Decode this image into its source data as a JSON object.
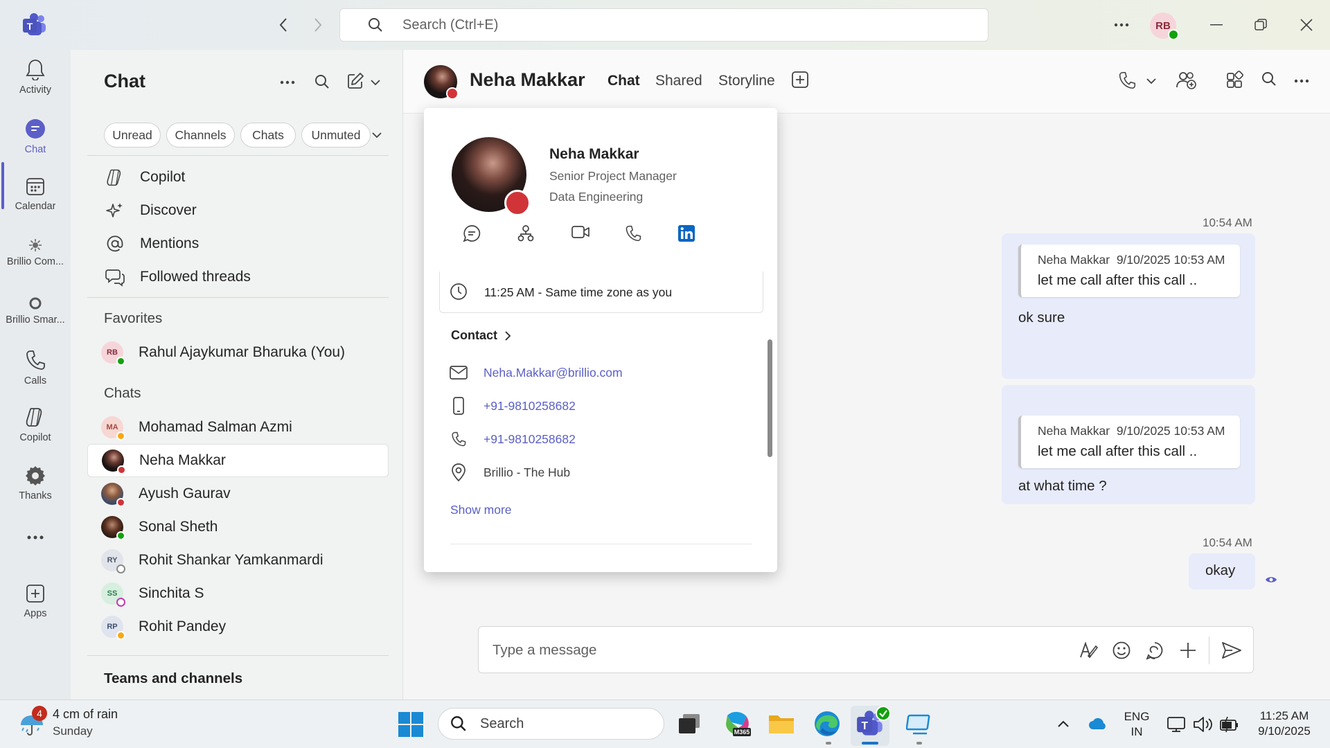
{
  "titlebar": {
    "search_placeholder": "Search (Ctrl+E)",
    "user_initials": "RB"
  },
  "rail": {
    "items": [
      {
        "label": "Activity"
      },
      {
        "label": "Chat"
      },
      {
        "label": "Calendar"
      },
      {
        "label": "Brillio Com..."
      },
      {
        "label": "Brillio Smar..."
      },
      {
        "label": "Calls"
      },
      {
        "label": "Copilot"
      },
      {
        "label": "Thanks"
      },
      {
        "label": "Apps"
      }
    ],
    "more_label": "..."
  },
  "list": {
    "title": "Chat",
    "filters": [
      "Unread",
      "Channels",
      "Chats",
      "Unmuted"
    ],
    "nav": [
      {
        "label": "Copilot"
      },
      {
        "label": "Discover"
      },
      {
        "label": "Mentions"
      },
      {
        "label": "Followed threads"
      }
    ],
    "favorites_heading": "Favorites",
    "favorites": [
      {
        "initials": "RB",
        "name": "Rahul Ajaykumar Bharuka (You)"
      }
    ],
    "chats_heading": "Chats",
    "chats": [
      {
        "initials": "MA",
        "name": "Mohamad Salman Azmi"
      },
      {
        "initials": "",
        "name": "Neha Makkar"
      },
      {
        "initials": "",
        "name": "Ayush Gaurav"
      },
      {
        "initials": "",
        "name": "Sonal Sheth"
      },
      {
        "initials": "RY",
        "name": "Rohit Shankar Yamkanmardi"
      },
      {
        "initials": "SS",
        "name": "Sinchita S"
      },
      {
        "initials": "RP",
        "name": "Rohit Pandey"
      }
    ],
    "teams_heading": "Teams and channels"
  },
  "header": {
    "name": "Neha Makkar",
    "tabs": [
      "Chat",
      "Shared",
      "Storyline"
    ]
  },
  "messages": [
    {
      "time": "10:54 AM",
      "quote_author": "Neha Makkar",
      "quote_time": "9/10/2025 10:53 AM",
      "quote_text": "let me call after this call ..",
      "text": "ok sure"
    },
    {
      "quote_author": "Neha Makkar",
      "quote_time": "9/10/2025 10:53 AM",
      "quote_text": "let me call after this call ..",
      "text": "at what time ?"
    },
    {
      "time": "10:54 AM",
      "text": "okay"
    }
  ],
  "composer": {
    "placeholder": "Type a message"
  },
  "card": {
    "name": "Neha Makkar",
    "title": "Senior Project Manager",
    "department": "Data Engineering",
    "local_time": "11:25 AM - Same time zone as you",
    "contact_heading": "Contact",
    "email": "Neha.Makkar@brillio.com",
    "mobile": "+91-9810258682",
    "phone": "+91-9810258682",
    "location": "Brillio - The Hub",
    "show_more": "Show more"
  },
  "taskbar": {
    "weather_badge": "4",
    "weather_title": "4 cm of rain",
    "weather_sub": "Sunday",
    "search_label": "Search",
    "m365_label": "M365",
    "lang_top": "ENG",
    "lang_bottom": "IN",
    "clock_time": "11:25 AM",
    "clock_date": "9/10/2025"
  },
  "colors": {
    "accent": "#5b5fc7",
    "presence_available": "#13a10e",
    "presence_busy": "#d13438",
    "presence_away": "#f8a815",
    "bubble": "#e8ebfa"
  }
}
